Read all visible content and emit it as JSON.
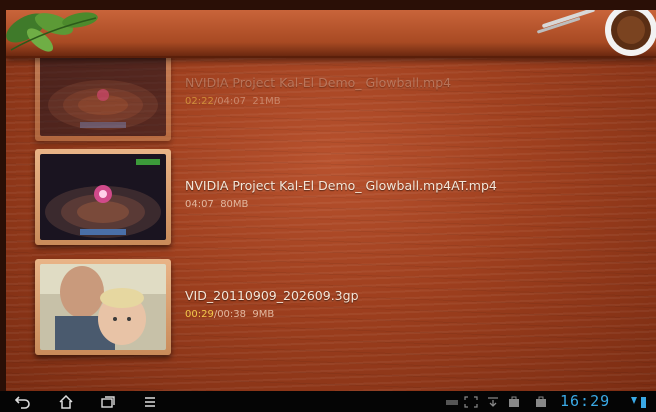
{
  "videos": [
    {
      "title": "NVIDIA Project Kal-El Demo_ Glowball.mp4",
      "played": "02:22",
      "duration": "/04:07",
      "size": "21MB",
      "thumb_icon": "game-scene-thumbnail"
    },
    {
      "title": "NVIDIA Project Kal-El Demo_ Glowball.mp4AT.mp4",
      "played": "",
      "duration": "04:07",
      "size": "80MB",
      "thumb_icon": "game-scene-thumbnail"
    },
    {
      "title": "VID_20110909_202609.3gp",
      "played": "00:29",
      "duration": "/00:38",
      "size": "9MB",
      "thumb_icon": "family-photo-thumbnail"
    }
  ],
  "status": {
    "clock": "16:29"
  },
  "colors": {
    "played_time": "#f2c84b",
    "clock": "#3aa9e6",
    "wood": "#9e3f1e"
  }
}
